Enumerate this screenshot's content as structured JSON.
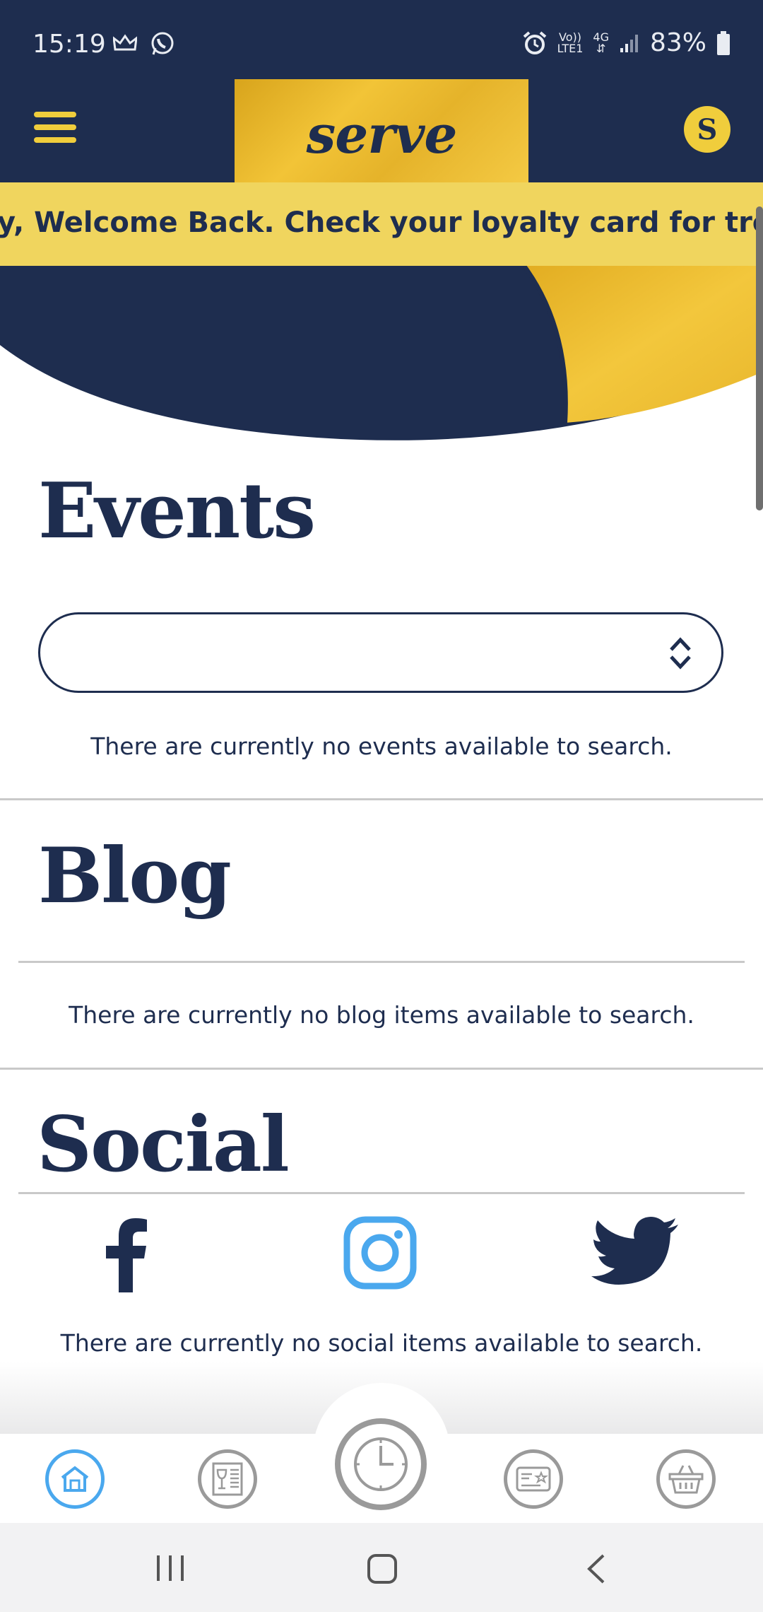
{
  "status_bar": {
    "time": "15:19",
    "volte_top": "Vo))",
    "volte_bottom": "LTE1",
    "network": "4G",
    "battery": "83%"
  },
  "header": {
    "logo": "serve",
    "icons": [
      "menu-icon",
      "serve-badge-icon"
    ]
  },
  "ticker": {
    "text": "y, Welcome Back. Check your loyalty card for treats"
  },
  "events": {
    "title": "Events",
    "select_value": "",
    "empty_message": "There are currently no events available to search."
  },
  "blog": {
    "title": "Blog",
    "empty_message": "There are currently no blog items available to search."
  },
  "social": {
    "title": "Social",
    "icons": [
      "facebook-icon",
      "instagram-icon",
      "twitter-icon"
    ],
    "empty_message": "There are currently no social items available to search."
  },
  "tab_bar": {
    "tabs": [
      "home-icon",
      "menu-card-icon",
      "clock-icon",
      "loyalty-card-icon",
      "basket-icon"
    ],
    "active": "home-icon"
  },
  "colors": {
    "navy": "#1e2d4f",
    "gold": "#f0cd3c",
    "ticker": "#f0d55e",
    "active_tab": "#4aa8ee",
    "instagram": "#4aa8ee"
  }
}
